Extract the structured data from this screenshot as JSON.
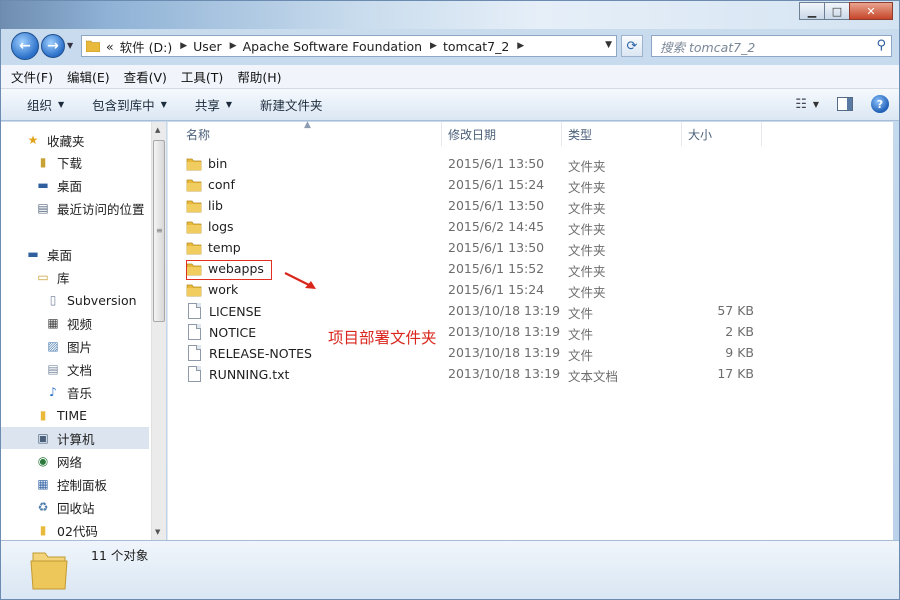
{
  "window": {
    "controls": {
      "minimize": "▁",
      "maximize": "□",
      "close": "✕"
    }
  },
  "address": {
    "lead": "«",
    "crumbs": [
      "软件 (D:)",
      "User",
      "Apache Software Foundation",
      "tomcat7_2"
    ],
    "search_placeholder": "搜索 tomcat7_2"
  },
  "menubar": [
    "文件(F)",
    "编辑(E)",
    "查看(V)",
    "工具(T)",
    "帮助(H)"
  ],
  "commandbar": {
    "organize": "组织",
    "include_in_library": "包含到库中",
    "share": "共享",
    "new_folder": "新建文件夹"
  },
  "nav": [
    {
      "label": "收藏夹",
      "icon": "star-icon"
    },
    {
      "label": "下载",
      "icon": "downloads-icon"
    },
    {
      "label": "桌面",
      "icon": "desktop-icon"
    },
    {
      "label": "最近访问的位置",
      "icon": "recent-places-icon"
    },
    {
      "label": "桌面",
      "icon": "desktop-icon"
    },
    {
      "label": "库",
      "icon": "library-icon"
    },
    {
      "label": "Subversion",
      "icon": "library-folder-icon"
    },
    {
      "label": "视频",
      "icon": "video-icon"
    },
    {
      "label": "图片",
      "icon": "pictures-icon"
    },
    {
      "label": "文档",
      "icon": "documents-icon"
    },
    {
      "label": "音乐",
      "icon": "music-icon"
    },
    {
      "label": "TIME",
      "icon": "folder-icon"
    },
    {
      "label": "计算机",
      "icon": "computer-icon"
    },
    {
      "label": "网络",
      "icon": "network-icon"
    },
    {
      "label": "控制面板",
      "icon": "control-panel-icon"
    },
    {
      "label": "回收站",
      "icon": "recycle-bin-icon"
    },
    {
      "label": "02代码",
      "icon": "folder-icon"
    }
  ],
  "columns": {
    "name": "名称",
    "date": "修改日期",
    "type": "类型",
    "size": "大小"
  },
  "files": [
    {
      "name": "bin",
      "date": "2015/6/1 13:50",
      "type": "文件夹",
      "size": "",
      "kind": "folder"
    },
    {
      "name": "conf",
      "date": "2015/6/1 15:24",
      "type": "文件夹",
      "size": "",
      "kind": "folder"
    },
    {
      "name": "lib",
      "date": "2015/6/1 13:50",
      "type": "文件夹",
      "size": "",
      "kind": "folder"
    },
    {
      "name": "logs",
      "date": "2015/6/2 14:45",
      "type": "文件夹",
      "size": "",
      "kind": "folder"
    },
    {
      "name": "temp",
      "date": "2015/6/1 13:50",
      "type": "文件夹",
      "size": "",
      "kind": "folder"
    },
    {
      "name": "webapps",
      "date": "2015/6/1 15:52",
      "type": "文件夹",
      "size": "",
      "kind": "folder"
    },
    {
      "name": "work",
      "date": "2015/6/1 15:24",
      "type": "文件夹",
      "size": "",
      "kind": "folder"
    },
    {
      "name": "LICENSE",
      "date": "2013/10/18 13:19",
      "type": "文件",
      "size": "57 KB",
      "kind": "file"
    },
    {
      "name": "NOTICE",
      "date": "2013/10/18 13:19",
      "type": "文件",
      "size": "2 KB",
      "kind": "file"
    },
    {
      "name": "RELEASE-NOTES",
      "date": "2013/10/18 13:19",
      "type": "文件",
      "size": "9 KB",
      "kind": "file"
    },
    {
      "name": "RUNNING.txt",
      "date": "2013/10/18 13:19",
      "type": "文本文档",
      "size": "17 KB",
      "kind": "file"
    }
  ],
  "annotation": {
    "text": "项目部署文件夹",
    "color": "#d9261c"
  },
  "status": {
    "count": "11 个对象"
  },
  "colors": {
    "folder": "#e8b93a",
    "selection": "#dbe4ef",
    "annotation": "#d9261c"
  }
}
